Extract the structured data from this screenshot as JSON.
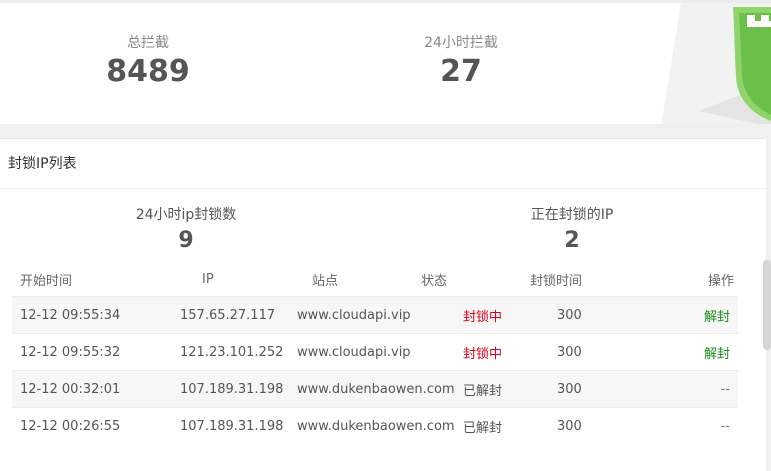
{
  "stats": {
    "total_label": "总拦截",
    "total_value": "8489",
    "day_label": "24小时拦截",
    "day_value": "27"
  },
  "section": {
    "title": "封锁IP列表"
  },
  "summary": {
    "day_blocked_label": "24小时ip封锁数",
    "day_blocked_value": "9",
    "current_blocked_label": "正在封锁的IP",
    "current_blocked_value": "2"
  },
  "table": {
    "headers": [
      "开始时间",
      "IP",
      "站点",
      "状态",
      "封锁时间",
      "操作"
    ],
    "rows": [
      {
        "start": "12-12 09:55:34",
        "ip": "157.65.27.117",
        "site": "www.cloudapi.vip",
        "status": "封锁中",
        "duration": "300",
        "action": "解封"
      },
      {
        "start": "12-12 09:55:32",
        "ip": "121.23.101.252",
        "site": "www.cloudapi.vip",
        "status": "封锁中",
        "duration": "300",
        "action": "解封"
      },
      {
        "start": "12-12 00:32:01",
        "ip": "107.189.31.198",
        "site": "www.dukenbaowen.com",
        "status": "已解封",
        "duration": "300",
        "action": "--"
      },
      {
        "start": "12-12 00:26:55",
        "ip": "107.189.31.198",
        "site": "www.dukenbaowen.com",
        "status": "已解封",
        "duration": "300",
        "action": "--"
      }
    ]
  },
  "colors": {
    "blocking_status": "#d9001b",
    "unblock_link": "#1a8a1a",
    "shield_green": "#6cc04a"
  },
  "icons": {
    "shield": "shield-icon"
  }
}
